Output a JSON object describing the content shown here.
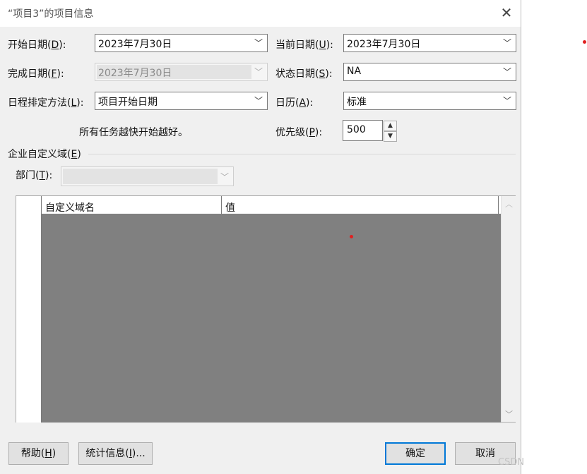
{
  "window": {
    "title": "“项目3”的项目信息"
  },
  "fields": {
    "start_date": {
      "label": "开始日期",
      "key": "D",
      "value": "2023年7月30日"
    },
    "current_date": {
      "label": "当前日期",
      "key": "U",
      "value": "2023年7月30日"
    },
    "finish_date": {
      "label": "完成日期",
      "key": "F",
      "value": "2023年7月30日"
    },
    "status_date": {
      "label": "状态日期",
      "key": "S",
      "value": "NA"
    },
    "schedule_from": {
      "label": "日程排定方法",
      "key": "L",
      "value": "项目开始日期"
    },
    "calendar": {
      "label": "日历",
      "key": "A",
      "value": "标准"
    },
    "schedule_note": "所有任务越快开始越好。",
    "priority": {
      "label": "优先级",
      "key": "P",
      "value": "500"
    }
  },
  "enterprise": {
    "section_label": "企业自定义域",
    "section_key": "E",
    "department": {
      "label": "部门",
      "key": "T",
      "value": ""
    },
    "table": {
      "columns": [
        "自定义域名",
        "值"
      ],
      "rows": []
    }
  },
  "buttons": {
    "help": {
      "label": "帮助",
      "key": "H"
    },
    "statistics": {
      "label": "统计信息",
      "key": "I",
      "suffix": "..."
    },
    "ok": "确定",
    "cancel": "取消"
  },
  "watermark": "CSDN"
}
